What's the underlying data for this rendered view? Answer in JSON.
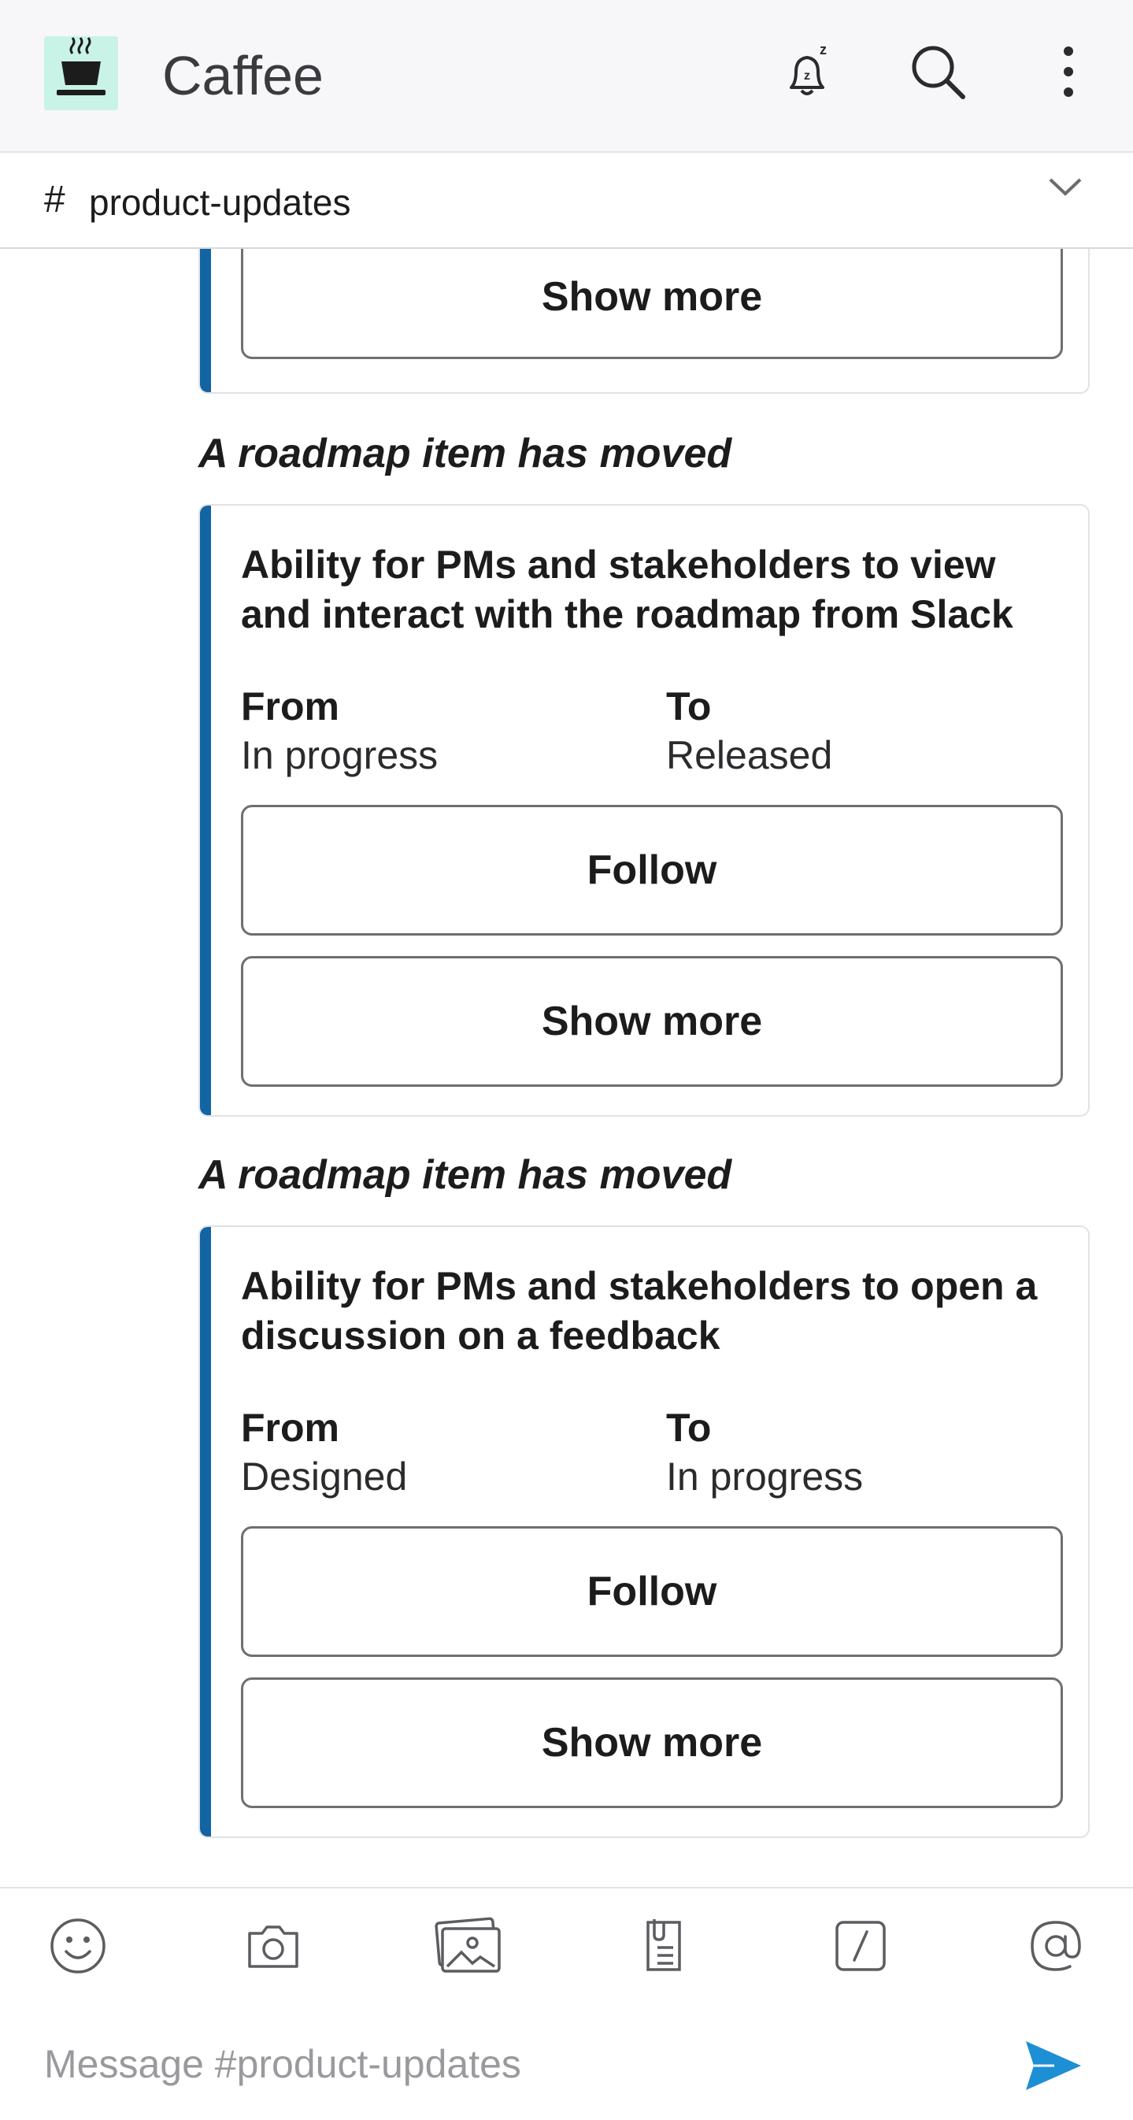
{
  "app": {
    "title": "Caffee"
  },
  "channel": {
    "hash": "#",
    "name": "product-updates"
  },
  "messages": [
    {
      "button_show_more": "Show more"
    },
    {
      "notice": "A roadmap item has moved",
      "title": "Ability for PMs and stakeholders to view and interact with the roadmap from Slack",
      "from_label": "From",
      "from_value": "In progress",
      "to_label": "To",
      "to_value": "Released",
      "button_follow": "Follow",
      "button_show_more": "Show more"
    },
    {
      "notice": "A roadmap item has moved",
      "title": "Ability for PMs and stakeholders to open a discussion on a feedback",
      "from_label": "From",
      "from_value": "Designed",
      "to_label": "To",
      "to_value": "In progress",
      "button_follow": "Follow",
      "button_show_more": "Show more"
    }
  ],
  "composer": {
    "placeholder": "Message #product-updates"
  },
  "colors": {
    "accent_bar": "#1264a3",
    "send": "#1d8fd4",
    "logo_bg": "#c9f3e6"
  },
  "icons": [
    "coffee-logo-icon",
    "snooze-bell-icon",
    "search-icon",
    "more-vertical-icon",
    "chevron-down-icon",
    "emoji-icon",
    "camera-icon",
    "photo-icon",
    "file-icon",
    "slash-command-icon",
    "mention-icon",
    "send-icon"
  ]
}
